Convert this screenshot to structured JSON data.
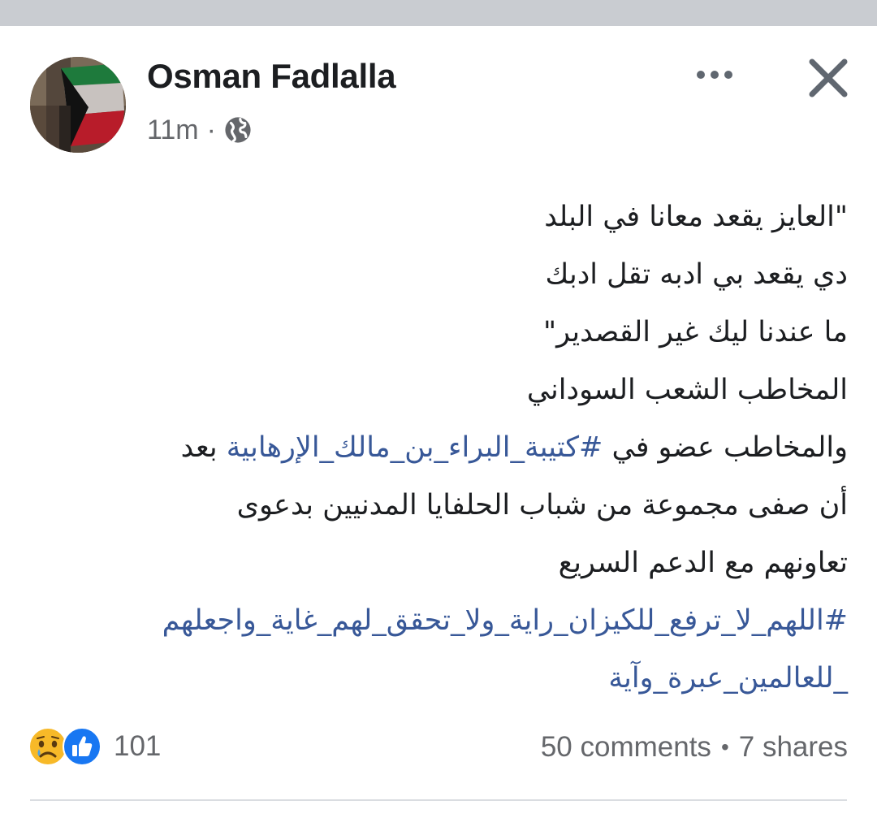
{
  "post": {
    "author": "Osman Fadlalla",
    "time": "11m",
    "separator": "·",
    "privacy_icon": "globe-icon",
    "body_lines": [
      "\"العايز يقعد معانا في البلد",
      "دي يقعد بي ادبه  تقل ادبك",
      "ما عندنا ليك غير القصدير\"",
      "المخاطب الشعب السوداني"
    ],
    "line5_prefix": "والمخاطب عضو في ",
    "line5_hashtag": "#كتيبة_البراء_بن_مالك_الإرهابية",
    "line5_suffix": " بعد",
    "line6": "أن صفى مجموعة من شباب الحلفايا  المدنيين بدعوى",
    "line7": "تعاونهم مع الدعم السريع",
    "hashtag2_line1": "#اللهم_لا_ترفع_للكيزان_راية_ولا_تحقق_لهم_غاية_واجعلهم",
    "hashtag2_line2": "_للعالمين_عبرة_وآية"
  },
  "actions": {
    "more_icon": "more-horizontal-icon",
    "close_icon": "close-icon"
  },
  "footer": {
    "reaction_icons": [
      "sad-reaction-icon",
      "like-reaction-icon"
    ],
    "reaction_count": "101",
    "comments": "50 comments",
    "bullet": "•",
    "shares": "7 shares"
  },
  "colors": {
    "text": "#1c1e21",
    "secondary": "#65676b",
    "hashtag": "#385898",
    "like_blue": "#1877f2",
    "sad_yellow": "#f7b928"
  }
}
